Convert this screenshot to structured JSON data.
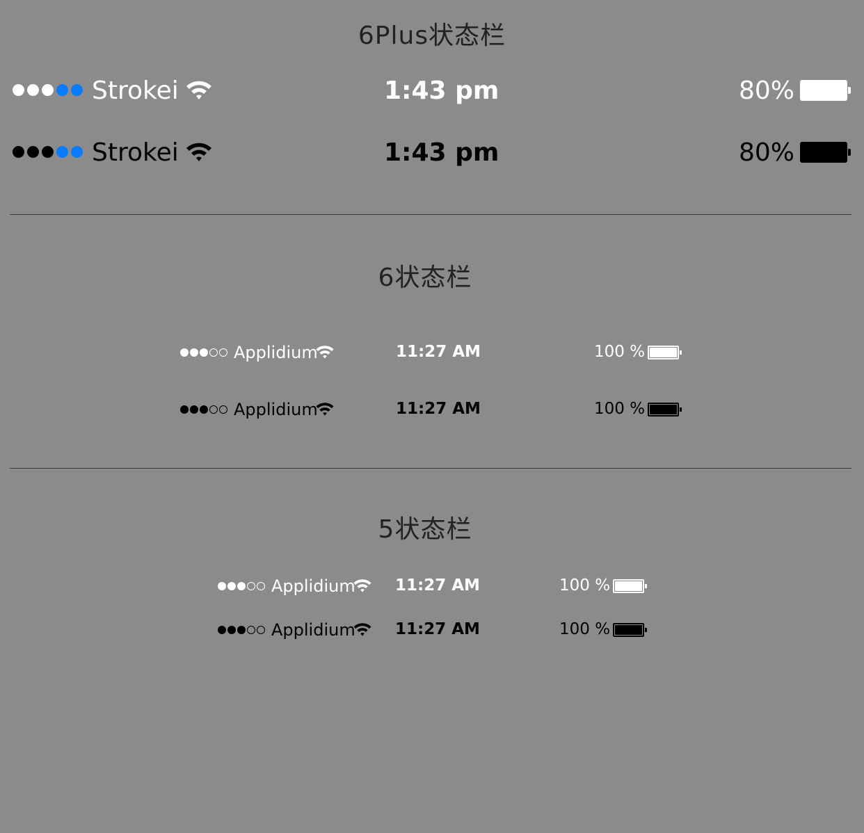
{
  "sections": [
    {
      "title": "6Plus状态栏",
      "bars": [
        {
          "theme": "light",
          "carrier": "Strokei",
          "time": "1:43 pm",
          "battery_text": "80%",
          "signal": [
            "#ffffff",
            "#ffffff",
            "#ffffff",
            "#0a7cff",
            "#0a7cff"
          ],
          "battery_level": 1.0
        },
        {
          "theme": "dark",
          "carrier": "Strokei",
          "time": "1:43 pm",
          "battery_text": "80%",
          "signal": [
            "#000000",
            "#000000",
            "#000000",
            "#0a7cff",
            "#0a7cff"
          ],
          "battery_level": 1.0
        }
      ]
    },
    {
      "title": "6状态栏",
      "bars": [
        {
          "theme": "light",
          "carrier": "Applidium",
          "time": "11:27 AM",
          "battery_text": "100 %",
          "signal": [
            "filled",
            "filled",
            "filled",
            "empty",
            "empty"
          ],
          "battery_level": 1.0
        },
        {
          "theme": "dark",
          "carrier": "Applidium",
          "time": "11:27 AM",
          "battery_text": "100 %",
          "signal": [
            "filled",
            "filled",
            "filled",
            "empty",
            "empty"
          ],
          "battery_level": 1.0
        }
      ]
    },
    {
      "title": "5状态栏",
      "bars": [
        {
          "theme": "light",
          "carrier": "Applidium",
          "time": "11:27 AM",
          "battery_text": "100 %",
          "signal": [
            "filled",
            "filled",
            "filled",
            "empty",
            "empty"
          ],
          "battery_level": 1.0
        },
        {
          "theme": "dark",
          "carrier": "Applidium",
          "time": "11:27 AM",
          "battery_text": "100 %",
          "signal": [
            "filled",
            "filled",
            "filled",
            "empty",
            "empty"
          ],
          "battery_level": 1.0
        }
      ]
    }
  ],
  "colors": {
    "background": "#8b8b8b",
    "accent_blue": "#0a7cff",
    "light": "#ffffff",
    "dark": "#000000"
  },
  "icons": [
    "signal-dots-icon",
    "wifi-icon",
    "battery-icon"
  ]
}
